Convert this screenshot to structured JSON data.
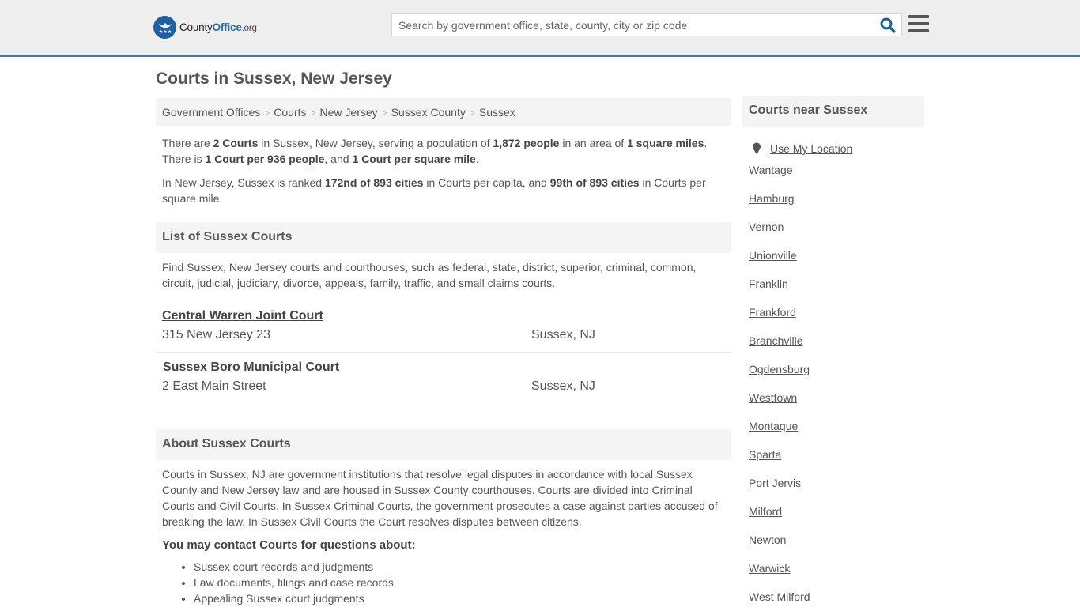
{
  "header": {
    "logo": {
      "part1": "County",
      "part2": "Office",
      "part3": ".org"
    },
    "search_placeholder": "Search by government office, state, county, city or zip code",
    "search_value": "",
    "colors": {
      "accent": "#3a7cad",
      "brand_blue": "#1f6cb5"
    }
  },
  "page": {
    "title": "Courts in Sussex, New Jersey"
  },
  "breadcrumb": [
    "Government Offices",
    "Courts",
    "New Jersey",
    "Sussex County",
    "Sussex"
  ],
  "summary": {
    "p1": {
      "t1": "There are ",
      "b1": "2 Courts",
      "t2": " in Sussex, New Jersey, serving a population of ",
      "b2": "1,872 people",
      "t3": " in an area of ",
      "b3": "1 square miles",
      "t4": ". There is ",
      "b4": "1 Court per 936 people",
      "t5": ", and ",
      "b5": "1 Court per square mile",
      "t6": "."
    },
    "p2": {
      "t1": "In New Jersey, Sussex is ranked ",
      "b1": "172nd of 893 cities",
      "t2": " in Courts per capita, and ",
      "b2": "99th of 893 cities",
      "t3": " in Courts per square mile."
    }
  },
  "list": {
    "heading": "List of Sussex Courts",
    "intro": "Find Sussex, New Jersey courts and courthouses, such as federal, state, district, superior, criminal, common, circuit, judicial, judiciary, divorce, appeals, family, traffic, and small claims courts.",
    "courts": [
      {
        "name": "Central Warren Joint Court",
        "address": "315 New Jersey 23",
        "city": "Sussex, NJ"
      },
      {
        "name": "Sussex Boro Municipal Court",
        "address": "2 East Main Street",
        "city": "Sussex, NJ"
      }
    ]
  },
  "about": {
    "heading": "About Sussex Courts",
    "text": "Courts in Sussex, NJ are government institutions that resolve legal disputes in accordance with local Sussex County and New Jersey law and are housed in Sussex County courthouses. Courts are divided into Criminal Courts and Civil Courts. In Sussex Criminal Courts, the government prosecutes a case against parties accused of breaking the law. In Sussex Civil Courts the Court resolves disputes between citizens.",
    "contact_heading": "You may contact Courts for questions about:",
    "questions": [
      "Sussex court records and judgments",
      "Law documents, filings and case records",
      "Appealing Sussex court judgments"
    ]
  },
  "sidebar": {
    "heading": "Courts near Sussex",
    "use_location": "Use My Location",
    "places": [
      "Wantage",
      "Hamburg",
      "Vernon",
      "Unionville",
      "Franklin",
      "Frankford",
      "Branchville",
      "Ogdensburg",
      "Westtown",
      "Montague",
      "Sparta",
      "Port Jervis",
      "Milford",
      "Newton",
      "Warwick",
      "West Milford"
    ]
  }
}
